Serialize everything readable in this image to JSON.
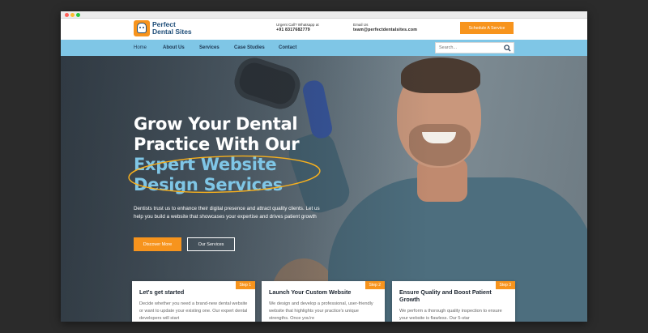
{
  "logo": {
    "line1": "Perfect",
    "line2": "Dental Sites"
  },
  "contact": {
    "phone_label": "Urgent Call? Whatsapp at",
    "phone": "+91 8317682779",
    "email_label": "Email Us",
    "email": "team@perfectdentalsites.com"
  },
  "header": {
    "cta_label": "Schedule A Service"
  },
  "nav": {
    "items": [
      "Home",
      "About Us",
      "Services",
      "Case Studies",
      "Contact"
    ],
    "search_placeholder": "Search..."
  },
  "hero": {
    "title_line1": "Grow Your Dental",
    "title_line2": "Practice With Our",
    "title_highlight1": "Expert Website",
    "title_highlight2": "Design Services",
    "description": "Dentists trust us to enhance their digital presence and attract quality clients. Let us help you build a website that showcases your expertise and drives patient growth",
    "primary_button": "Discover More",
    "secondary_button": "Our Services"
  },
  "cards": [
    {
      "step": "Step 1",
      "title": "Let's get started",
      "text": "Decide whether you need a brand-new dental website or want to update your existing one. Our expert dental developers will start"
    },
    {
      "step": "Step 2",
      "title": "Launch Your Custom Website",
      "text": "We design and develop a professional, user-friendly website that highlights your practice's unique strengths. Once you're"
    },
    {
      "step": "Step 3",
      "title": "Ensure Quality and Boost Patient Growth",
      "text": "We perform a thorough quality inspection to ensure your website is flawless. Our 5-star"
    }
  ],
  "colors": {
    "accent": "#f7941d",
    "nav_bg": "#7fc6e6",
    "brand": "#1f4e79"
  }
}
